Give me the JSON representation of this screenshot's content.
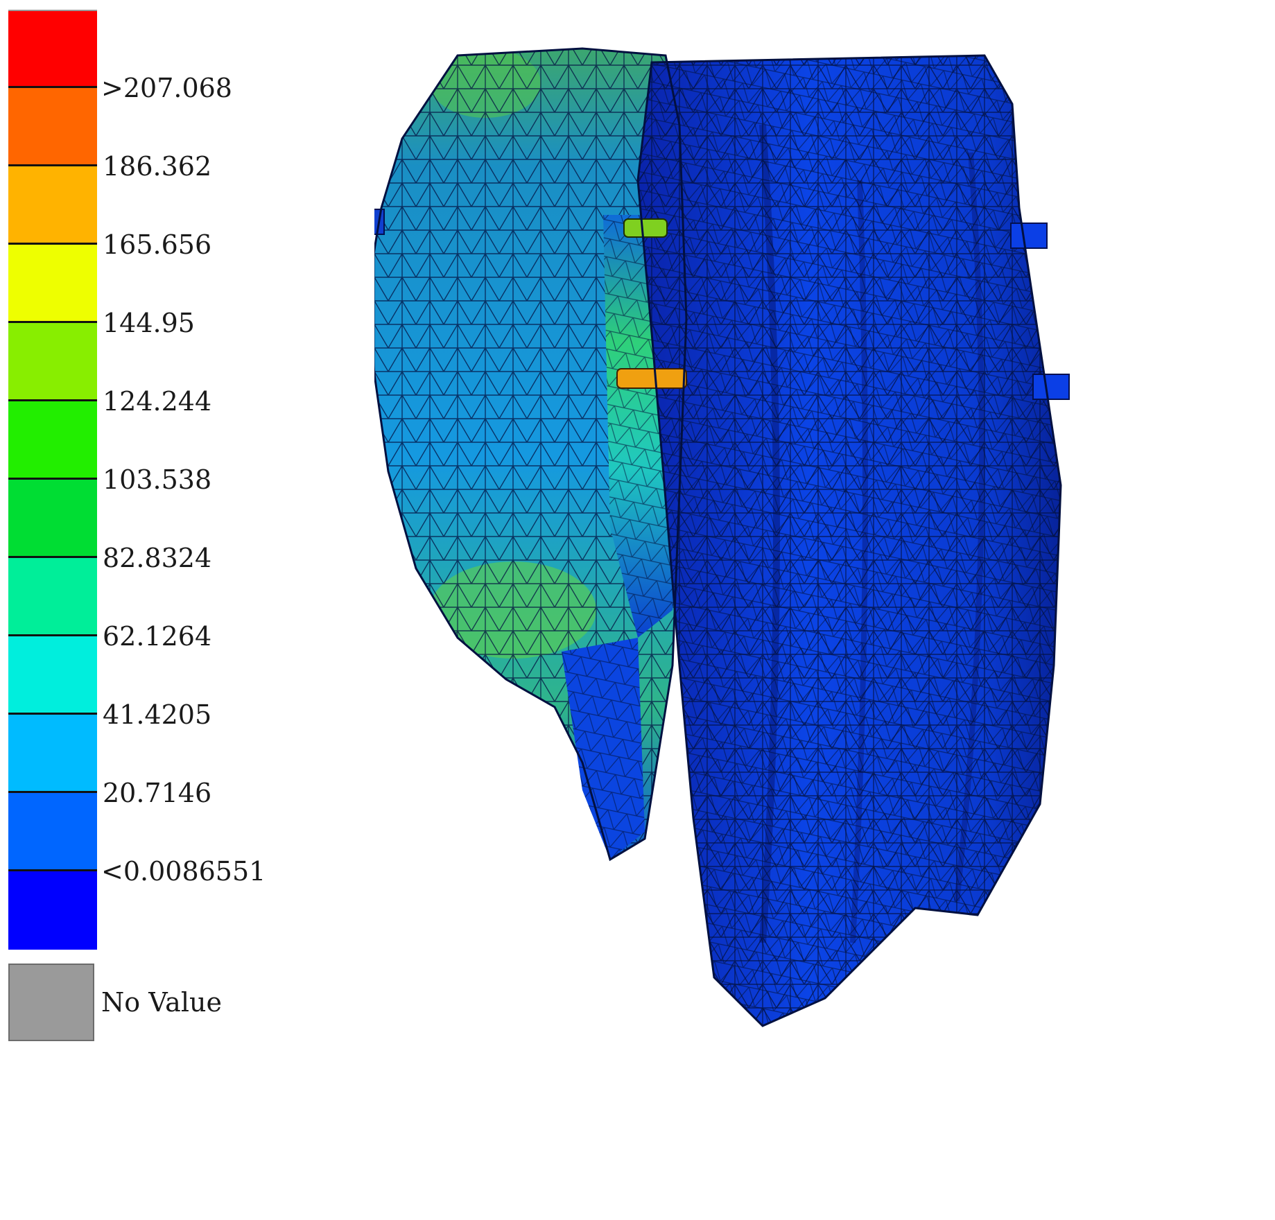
{
  "legend": {
    "bands": [
      {
        "color": "#ff0000"
      },
      {
        "color": "#ff6600"
      },
      {
        "color": "#ffb300"
      },
      {
        "color": "#eeff00"
      },
      {
        "color": "#88ee00"
      },
      {
        "color": "#22ee00"
      },
      {
        "color": "#00dd33"
      },
      {
        "color": "#00ee99"
      },
      {
        "color": "#00eedd"
      },
      {
        "color": "#00bbff"
      },
      {
        "color": "#0066ff"
      },
      {
        "color": "#0000ff"
      }
    ],
    "ticks": [
      ">207.068",
      "186.362",
      "165.656",
      "144.95",
      "124.244",
      "103.538",
      "82.8324",
      "62.1264",
      "41.4205",
      "20.7146",
      "<0.0086551"
    ],
    "no_value": {
      "label": "No Value",
      "color": "#9a9a9a"
    }
  },
  "viewport": {
    "model": "tetrahedral-mesh-stress-result",
    "palette": {
      "deep_blue": "#0a2fc8",
      "mid_blue": "#0b3fe6",
      "light_blue": "#1599e0",
      "cyan": "#1fb5d6",
      "green": "#4fce3a",
      "hotspot": "#f0a010"
    }
  }
}
